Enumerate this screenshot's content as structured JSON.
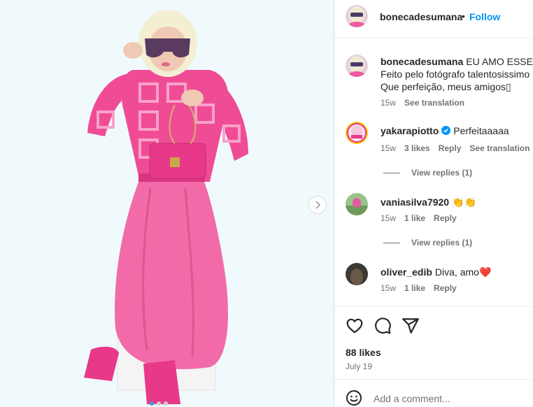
{
  "post": {
    "username": "bonecadesumana",
    "separator": "•",
    "follow_label": "Follow"
  },
  "caption": {
    "username": "bonecadesumana",
    "line1": "EU AMO ESSE EN",
    "line2": "Feito pelo fotógrafo talentosissimo",
    "line3": "Que perfeição, meus amigos▯",
    "time": "15w",
    "see_translation": "See translation"
  },
  "comments": [
    {
      "username": "yakarapiotto",
      "verified": true,
      "text": "Perfeitaaaaa",
      "time": "15w",
      "likes": "3 likes",
      "reply": "Reply",
      "see_translation": "See translation",
      "view_replies": "View replies (1)"
    },
    {
      "username": "vaniasilva7920",
      "verified": false,
      "text": "👏👏",
      "time": "15w",
      "likes": "1 like",
      "reply": "Reply",
      "view_replies": "View replies (1)"
    },
    {
      "username": "oliver_edib",
      "verified": false,
      "text": "Diva, amo❤️",
      "time": "15w",
      "likes": "1 like",
      "reply": "Reply"
    }
  ],
  "actions": {
    "like_icon": "heart-icon",
    "comment_icon": "comment-icon",
    "share_icon": "send-icon"
  },
  "likes_count": "88 likes",
  "date": "July 19",
  "add_comment_placeholder": "Add a comment...",
  "carousel": {
    "slides": 3,
    "active_index": 0
  },
  "colors": {
    "accent": "#0095f6",
    "background": "#f0fafd",
    "pink": "#f05aa0"
  }
}
